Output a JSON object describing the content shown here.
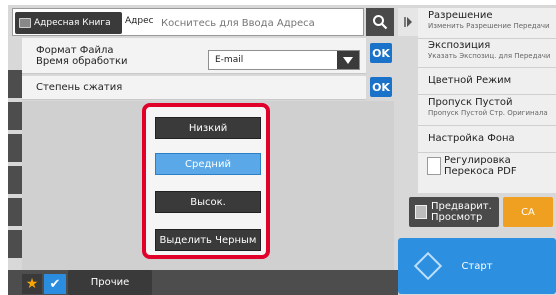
{
  "address_bar": {
    "address_book_label": "Адресная Книга",
    "address_label": "Адрес",
    "input_placeholder": "Коснитесь для Ввода Адреса"
  },
  "settings": {
    "row1_label_line1": "Формат Файла",
    "row1_label_line2": "Время обработки",
    "format_value": "E-mail",
    "ok_label": "OK",
    "row2_label": "Степень сжатия"
  },
  "compression_options": [
    {
      "label": "Низкий",
      "selected": false
    },
    {
      "label": "Средний",
      "selected": true
    },
    {
      "label": "Высок.",
      "selected": false
    },
    {
      "label": "Выделить Черным",
      "selected": false
    }
  ],
  "right_panel": {
    "items": [
      {
        "title": "Разрешение",
        "subtitle": "Изменить Разрешение Передачи"
      },
      {
        "title": "Экспозиция",
        "subtitle": "Указать Экспозиц. для Передачи"
      },
      {
        "title": "Цветной Режим",
        "subtitle": ""
      },
      {
        "title": "Пропуск Пустой",
        "subtitle": "Пропуск Пустой Стр. Оригинала"
      },
      {
        "title": "Настройка Фона",
        "subtitle": ""
      }
    ],
    "pdf_skew_line1": "Регулировка",
    "pdf_skew_line2": "Перекоса PDF",
    "preview_line1": "Предварит.",
    "preview_line2": "Просмотр",
    "ca_label": "CA",
    "start_label": "Старт"
  },
  "bottom": {
    "other_label": "Прочие"
  },
  "colors": {
    "accent_blue": "#1a73c9",
    "selected_option": "#5aa8e8",
    "highlight_red": "#e0002a",
    "ca_orange": "#f0a020",
    "start_blue": "#2d8fe0"
  }
}
